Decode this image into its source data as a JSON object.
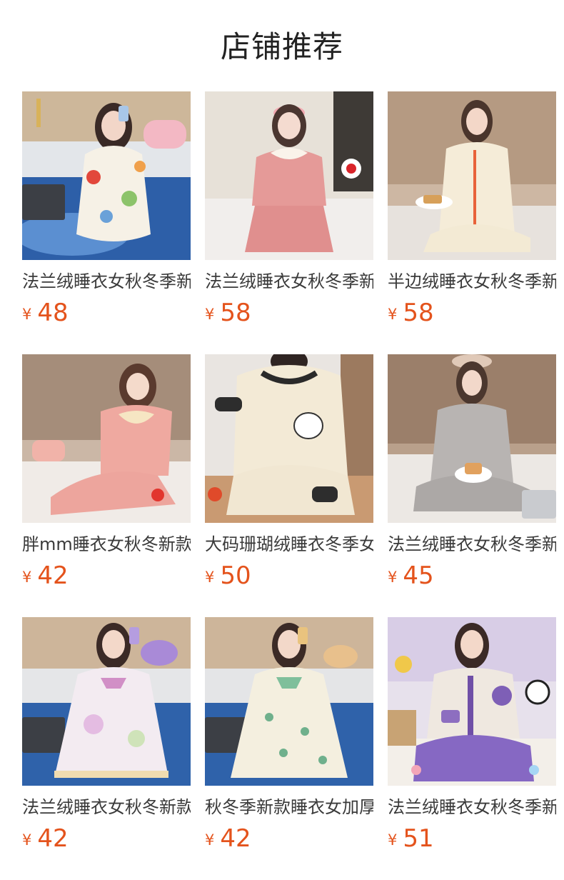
{
  "page_title": "店铺推荐",
  "currency_symbol": "¥",
  "products": [
    {
      "name": "法兰绒睡衣女秋冬季新款",
      "price": "48",
      "image": "woman-white-fruit-print-pajamas-photo"
    },
    {
      "name": "法兰绒睡衣女秋冬季新款",
      "price": "58",
      "image": "woman-pink-pajamas-photo"
    },
    {
      "name": "半边绒睡衣女秋冬季新款",
      "price": "58",
      "image": "woman-cream-pajamas-photo"
    },
    {
      "name": "胖mm睡衣女秋冬新款",
      "price": "42",
      "image": "woman-pink-ruffle-pajamas-photo"
    },
    {
      "name": "大码珊瑚绒睡衣冬季女",
      "price": "50",
      "image": "woman-cream-lucky-pajamas-photo"
    },
    {
      "name": "法兰绒睡衣女秋冬季新款",
      "price": "45",
      "image": "woman-grey-pajamas-photo"
    },
    {
      "name": "法兰绒睡衣女秋冬新款",
      "price": "42",
      "image": "woman-pastel-nightgown-photo"
    },
    {
      "name": "秋冬季新款睡衣女加厚",
      "price": "42",
      "image": "woman-cream-green-nightgown-photo"
    },
    {
      "name": "法兰绒睡衣女秋冬季新款",
      "price": "51",
      "image": "woman-purple-pajamas-photo"
    }
  ]
}
